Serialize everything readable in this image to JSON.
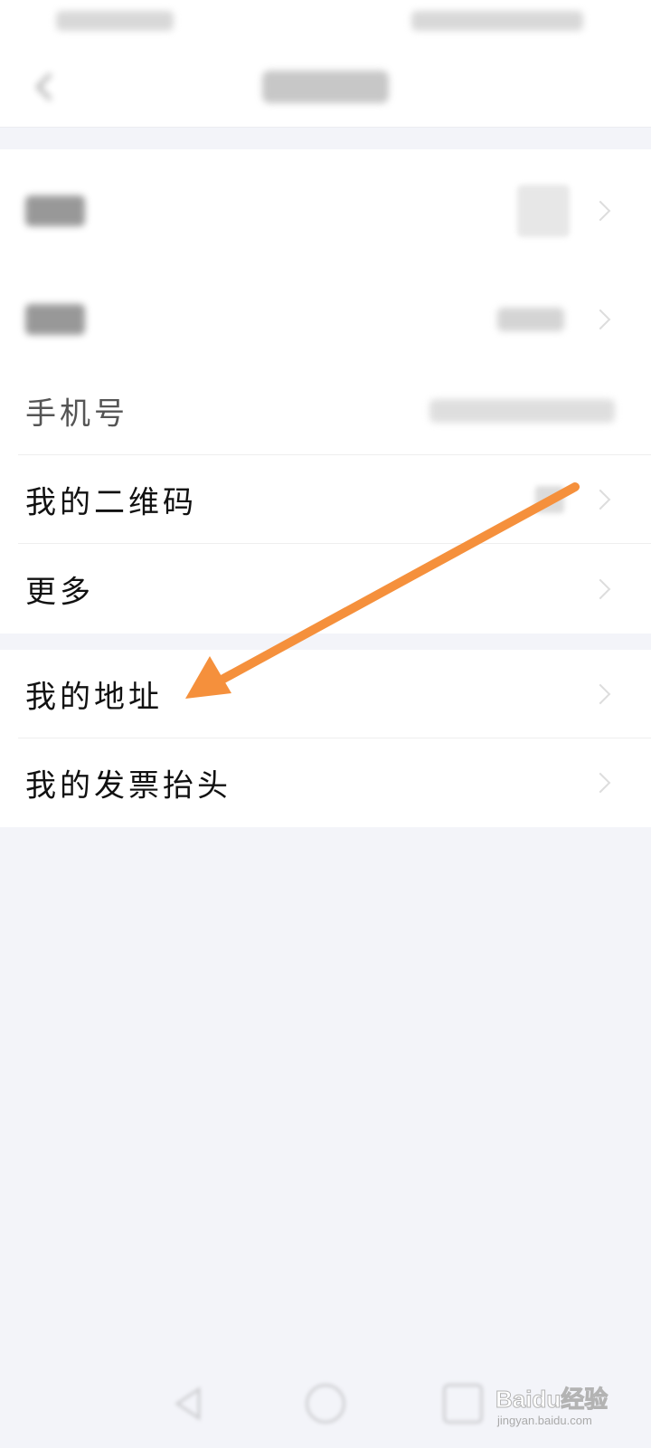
{
  "settings": {
    "rows": [
      {
        "id": "avatar",
        "label": ""
      },
      {
        "id": "nickname",
        "label": ""
      },
      {
        "id": "phone",
        "label": "手机号"
      },
      {
        "id": "qrcode",
        "label": "我的二维码"
      },
      {
        "id": "more",
        "label": "更多"
      }
    ],
    "rows2": [
      {
        "id": "address",
        "label": "我的地址"
      },
      {
        "id": "invoice",
        "label": "我的发票抬头"
      }
    ]
  },
  "annotation": {
    "arrow_color": "#f5903c",
    "target": "我的地址"
  },
  "watermark": {
    "brand": "Baidu经验",
    "sub": "jingyan.baidu.com"
  },
  "colors": {
    "background": "#f3f4f9",
    "card": "#ffffff",
    "text": "#111111",
    "arrow": "#f5903c"
  },
  "icons": {
    "back": "chevron-left-icon",
    "row_arrow": "chevron-right-icon"
  }
}
